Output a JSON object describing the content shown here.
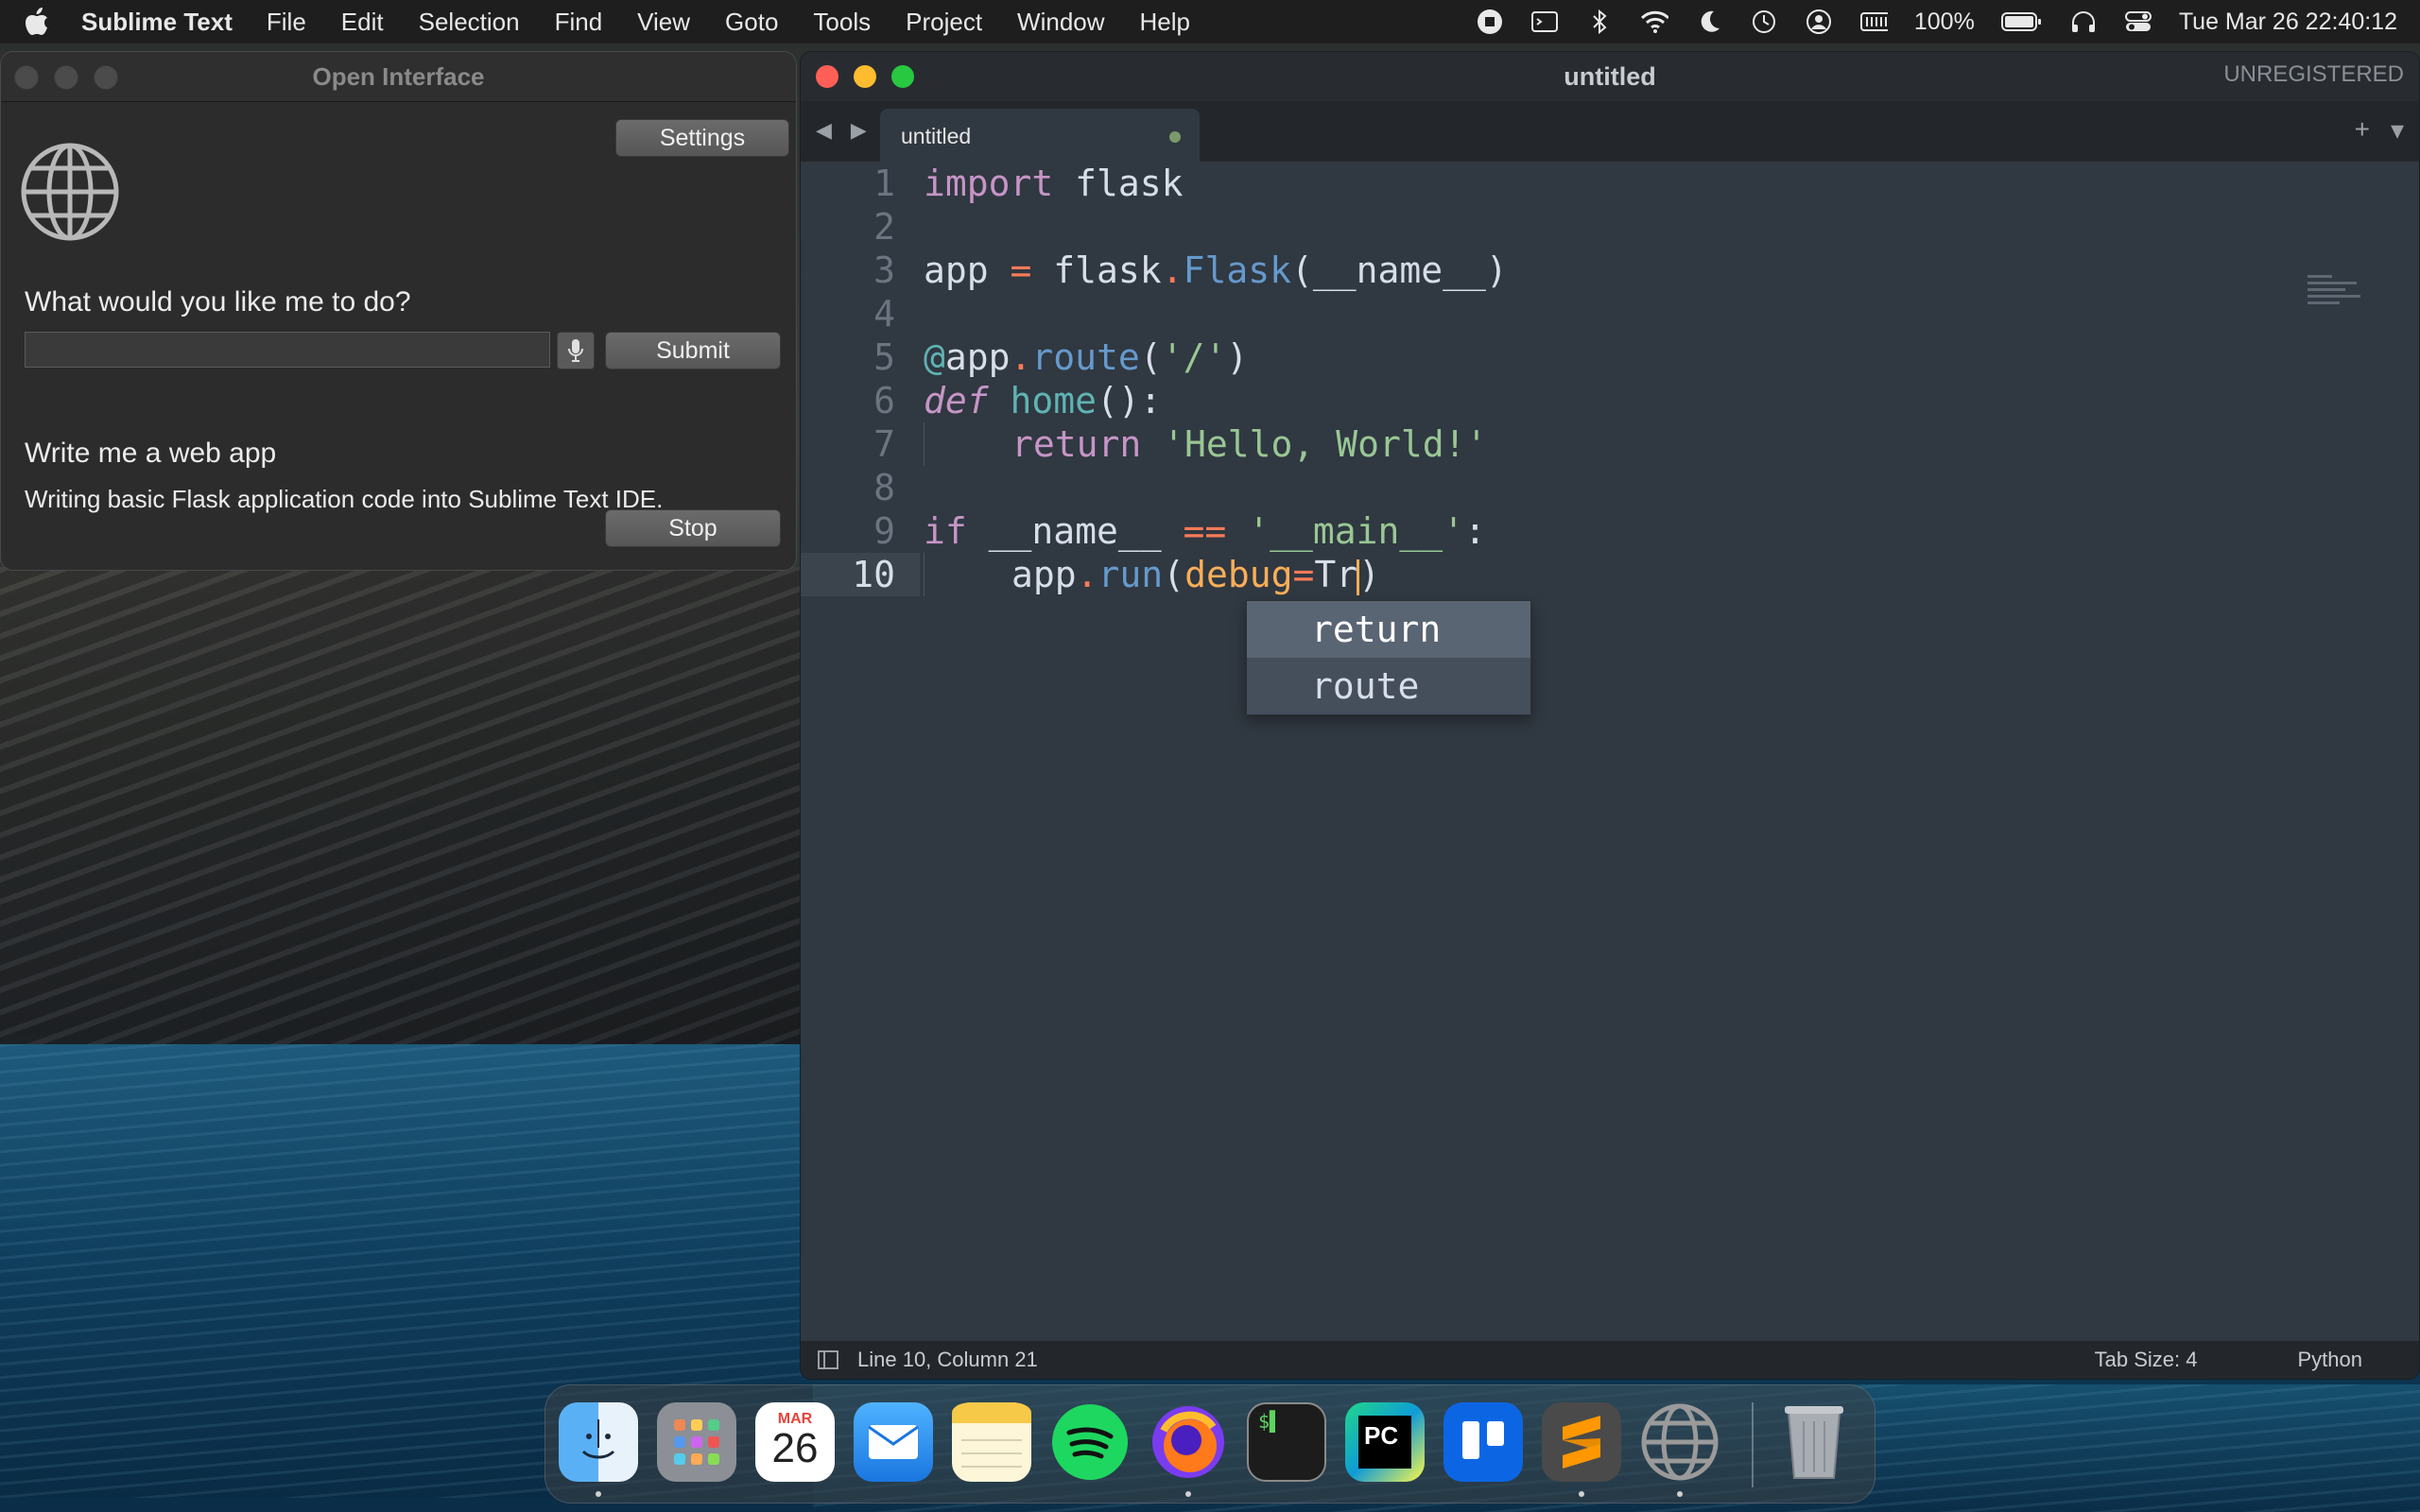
{
  "menubar": {
    "app": "Sublime Text",
    "items": [
      "File",
      "Edit",
      "Selection",
      "Find",
      "View",
      "Goto",
      "Tools",
      "Project",
      "Window",
      "Help"
    ],
    "battery": "100%",
    "datetime": "Tue Mar 26  22:40:12"
  },
  "open_interface": {
    "title": "Open Interface",
    "settings_label": "Settings",
    "prompt": "What would you like me to do?",
    "input_value": "",
    "submit_label": "Submit",
    "task": "Write me a web app",
    "status": "Writing basic Flask application code into Sublime Text IDE.",
    "stop_label": "Stop"
  },
  "sublime": {
    "title": "untitled",
    "registration": "UNREGISTERED",
    "tab_label": "untitled",
    "line_numbers": [
      "1",
      "2",
      "3",
      "4",
      "5",
      "6",
      "7",
      "8",
      "9",
      "10"
    ],
    "autocomplete": [
      "return",
      "route"
    ],
    "status_position": "Line 10, Column 21",
    "tab_size": "Tab Size: 4",
    "syntax": "Python"
  },
  "code": {
    "l1": {
      "kw": "import",
      "mod": " flask"
    },
    "l3": {
      "a": "app ",
      "eq": "=",
      "b": " flask",
      "dot": ".",
      "cls": "Flask",
      "args": "(__name__)"
    },
    "l5": {
      "at": "@",
      "app": "app",
      "dot": ".",
      "fn": "route",
      "open": "(",
      "str": "'/'",
      "close": ")"
    },
    "l6": {
      "kw": "def",
      "sp": " ",
      "fn": "home",
      "rest": "():"
    },
    "l7": {
      "kw": "return",
      "sp": " ",
      "str": "'Hello, World!'"
    },
    "l9": {
      "kw": "if",
      "a": " __name__ ",
      "op": "==",
      "sp": " ",
      "str": "'__main__'",
      "colon": ":"
    },
    "l10": {
      "app": "app",
      "dot": ".",
      "fn": "run",
      "open": "(",
      "arg": "debug",
      "eq": "=",
      "val": "Tr",
      "close": ")"
    }
  },
  "dock": {
    "calendar_month": "MAR",
    "calendar_day": "26",
    "apps": [
      "finder",
      "launchpad",
      "calendar",
      "mail",
      "notes",
      "spotify",
      "firefox",
      "terminal",
      "pycharm",
      "trello",
      "sublime-text",
      "open-interface",
      "trash"
    ]
  },
  "colors": {
    "close": "#ff5f57",
    "minimize": "#febc2e",
    "zoom": "#28c840",
    "editor_bg": "#303841"
  }
}
